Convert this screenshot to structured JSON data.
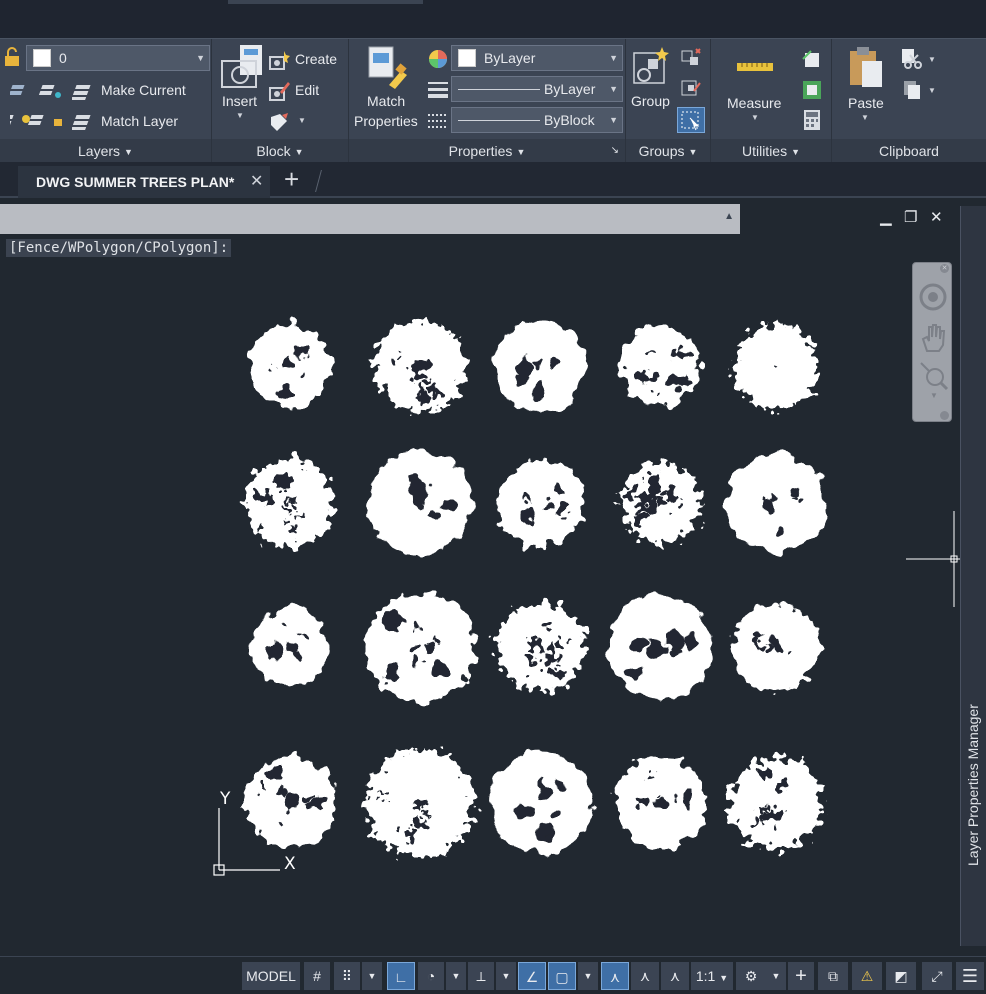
{
  "ribbon": {
    "layers": {
      "title": "Layers",
      "current_layer": "0",
      "make_current_label": "Make Current",
      "match_layer_label": "Match Layer"
    },
    "block": {
      "title": "Block",
      "insert_label": "Insert",
      "create_label": "Create",
      "edit_label": "Edit"
    },
    "properties": {
      "title": "Properties",
      "match_label_line1": "Match",
      "match_label_line2": "Properties",
      "color_value": "ByLayer",
      "lineweight_value": "ByLayer",
      "linetype_value": "ByBlock"
    },
    "groups": {
      "title": "Groups",
      "group_label": "Group"
    },
    "utilities": {
      "title": "Utilities",
      "measure_label": "Measure"
    },
    "clipboard": {
      "title": "Clipboard",
      "paste_label": "Paste"
    }
  },
  "tabs": {
    "document_title": "DWG SUMMER TREES PLAN*",
    "close_glyph": "✕",
    "new_tab_glyph": "+"
  },
  "command": {
    "prompt_text": "[Fence/WPolygon/CPolygon]:"
  },
  "window_controls": {
    "minimize": "▁",
    "restore": "❐",
    "close": "✕"
  },
  "ucs": {
    "x_label": "X",
    "y_label": "Y"
  },
  "palette": {
    "label": "Layer Properties Manager"
  },
  "statusbar": {
    "model_label": "MODEL",
    "scale_label": "1:1"
  },
  "colors": {
    "background": "#212830",
    "ribbon": "#3b4453",
    "accent_active": "#3f6fa6",
    "tree_fill": "#ffffff"
  }
}
